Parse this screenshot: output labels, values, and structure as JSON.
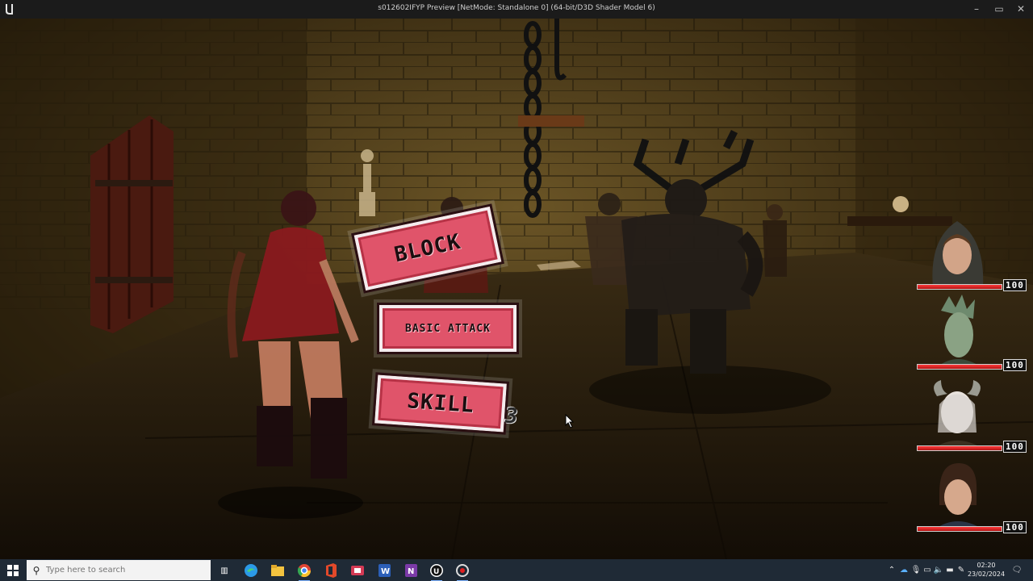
{
  "window": {
    "title": "s012602IFYP Preview [NetMode: Standalone 0]  (64-bit/D3D Shader Model 6)",
    "minimize_icon": "minimize-icon",
    "maximize_icon": "maximize-icon",
    "close_icon": "close-icon"
  },
  "actions": {
    "block_label": "BLOCK",
    "basic_attack_label": "BASIC ATTACK",
    "skill_label": "SKILL",
    "skill_count": "3"
  },
  "party": [
    {
      "hp_text": "100",
      "hp_fraction": 1.0,
      "icon": "hooded-woman-portrait"
    },
    {
      "hp_text": "100",
      "hp_fraction": 1.0,
      "icon": "reptilian-portrait"
    },
    {
      "hp_text": "100",
      "hp_fraction": 1.0,
      "icon": "horned-pale-portrait"
    },
    {
      "hp_text": "100",
      "hp_fraction": 1.0,
      "icon": "dark-haired-woman-portrait"
    }
  ],
  "taskbar": {
    "search_placeholder": "Type here to search",
    "apps": [
      "task-view-icon",
      "edge-icon",
      "file-explorer-icon",
      "chrome-icon",
      "office-icon",
      "app-icon",
      "word-icon",
      "onenote-icon",
      "unreal-engine-icon",
      "recorder-icon"
    ],
    "clock_time": "02:20",
    "clock_date": "23/02/2024"
  },
  "colors": {
    "button_fill": "#e0546a",
    "button_border": "#f4ecee",
    "hp_red": "#e02020",
    "taskbar": "#1f2a36"
  }
}
